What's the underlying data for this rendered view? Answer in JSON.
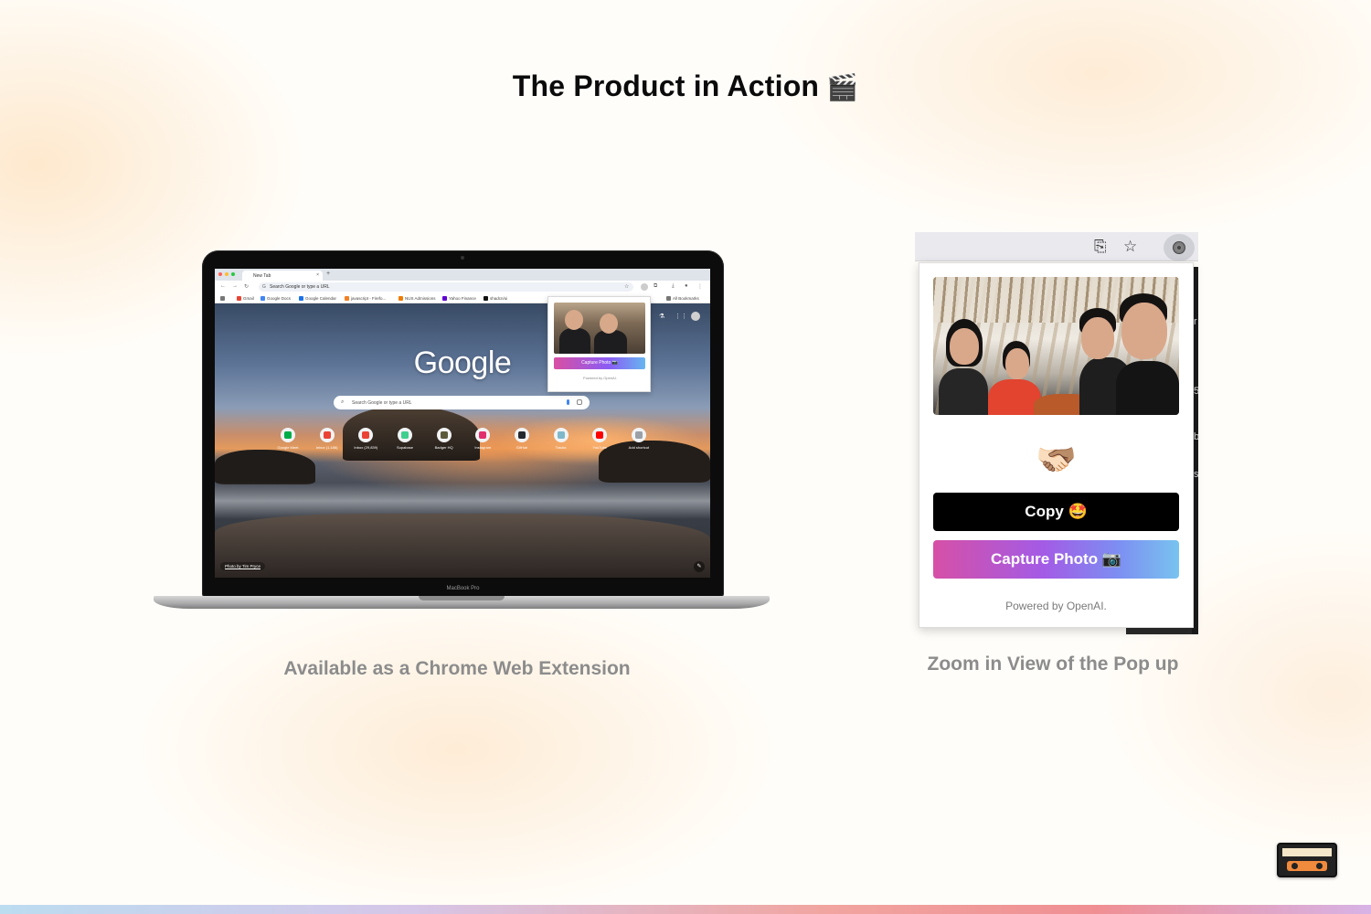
{
  "page": {
    "title": "The Product in Action",
    "title_emoji": "🎬",
    "caption_left": "Available as a Chrome Web Extension",
    "caption_right": "Zoom in View of the Pop up"
  },
  "laptop": {
    "model_label": "MacBook Pro",
    "browser": {
      "tab_title": "New Tab",
      "tab_close": "×",
      "new_tab": "+",
      "omnibox_placeholder": "Search Google or type a URL",
      "bookmarks": [
        {
          "label": "Gmail",
          "color": "#ea4335"
        },
        {
          "label": "Google Docs",
          "color": "#4285f4"
        },
        {
          "label": "Google Calendar",
          "color": "#1a73e8"
        },
        {
          "label": "javascript - Firefo...",
          "color": "#f48024"
        },
        {
          "label": "NUS Admissions",
          "color": "#ef7c00"
        },
        {
          "label": "Yahoo Finance",
          "color": "#6001d2"
        },
        {
          "label": "shadcn/ui",
          "color": "#111111"
        }
      ],
      "all_bookmarks": "All Bookmarks",
      "google_logo": "Google",
      "search_placeholder": "Search Google or type a URL",
      "shortcuts": [
        {
          "label": "Google Meet",
          "color": "#00ac47"
        },
        {
          "label": "Inbox (1,186)",
          "color": "#ea4335"
        },
        {
          "label": "Inbox (29,839)",
          "color": "#ea4335"
        },
        {
          "label": "Supabase",
          "color": "#3ecf8e"
        },
        {
          "label": "Badger HQ",
          "color": "#5b5b3c"
        },
        {
          "label": "Instagram",
          "color": "#e1306c"
        },
        {
          "label": "GitHub",
          "color": "#24292e"
        },
        {
          "label": "Tracks",
          "color": "#7fb8c9"
        },
        {
          "label": "YouTube",
          "color": "#ff0000"
        },
        {
          "label": "Add shortcut",
          "color": "#9aa0a6"
        }
      ],
      "photo_credit": "Photo by Tim Pryce",
      "mini_popup": {
        "capture_label": "Capture Photo 📷",
        "powered_label": "Powered by OpenAI."
      }
    }
  },
  "popup": {
    "reaction_emoji": "🫱🏻‍🫲🏽",
    "copy_label": "Copy 🤩",
    "capture_label": "Capture Photo 📷",
    "powered_label": "Powered by OpenAI."
  },
  "colors": {
    "capture_gradient_start": "#d650a6",
    "capture_gradient_end": "#78c3ef",
    "copy_button": "#000000",
    "caption_text": "#8c8c8c"
  }
}
